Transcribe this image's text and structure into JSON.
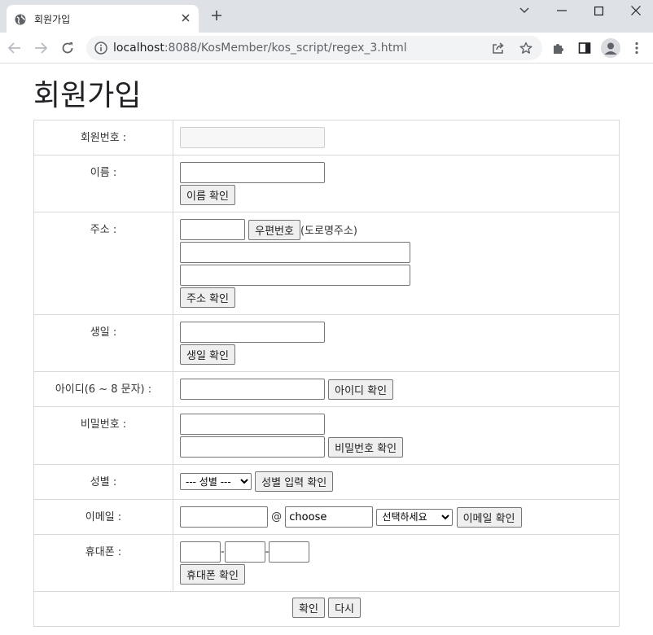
{
  "browser": {
    "tab_title": "회원가입",
    "url_host": "localhost",
    "url_rest": ":8088/KosMember/kos_script/regex_3.html",
    "icons": [
      "globe-icon",
      "close-icon",
      "plus-icon",
      "chevron-down-icon",
      "minimize-icon",
      "maximize-icon",
      "window-close-icon",
      "back-arrow-icon",
      "forward-arrow-icon",
      "reload-icon",
      "info-icon",
      "share-icon",
      "star-icon",
      "puzzle-icon",
      "sidepanel-icon",
      "profile-icon",
      "kebab-menu-icon"
    ]
  },
  "page": {
    "title": "회원가입"
  },
  "form": {
    "member_no": {
      "label": "회원번호 :",
      "value": ""
    },
    "name": {
      "label": "이름 :",
      "value": "",
      "button": "이름 확인"
    },
    "address": {
      "label": "주소 :",
      "zip_value": "",
      "zip_button": "우편번호",
      "zip_note": "(도로명주소)",
      "line1": "",
      "line2": "",
      "button": "주소 확인"
    },
    "birth": {
      "label": "생일 :",
      "value": "",
      "button": "생일 확인"
    },
    "userid": {
      "label": "아이디(6 ~ 8 문자) :",
      "value": "",
      "button": "아이디 확인"
    },
    "password": {
      "label": "비밀번호 :",
      "value": "",
      "confirm_value": "",
      "button": "비밀번호 확인"
    },
    "gender": {
      "label": "성별 :",
      "selected": "--- 성별 ---",
      "button": "성별 입력 확인"
    },
    "email": {
      "label": "이메일 :",
      "local": "",
      "at": "@",
      "domain": "choose",
      "select": "선택하세요",
      "button": "이메일 확인"
    },
    "phone": {
      "label": "휴대폰 :",
      "p1": "",
      "p2": "",
      "p3": "",
      "sep": "-",
      "button": "휴대폰 확인"
    },
    "submit": "확인",
    "reset": "다시"
  }
}
